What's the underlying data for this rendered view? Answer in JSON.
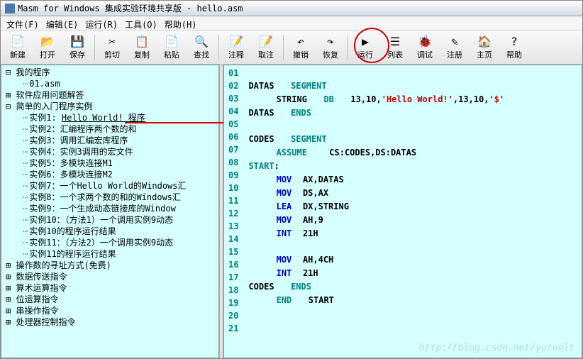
{
  "title": "Masm for Windows 集成实验环境共享版 - hello.asm",
  "menu": [
    "文件(F)",
    "编辑(E)",
    "运行(R)",
    "工具(O)",
    "帮助(H)"
  ],
  "toolbar": [
    {
      "name": "new",
      "icon": "📄",
      "label": "新建"
    },
    {
      "name": "open",
      "icon": "📂",
      "label": "打开"
    },
    {
      "name": "save",
      "icon": "💾",
      "label": "保存"
    },
    {
      "sep": true
    },
    {
      "name": "cut",
      "icon": "✂",
      "label": "剪切"
    },
    {
      "name": "copy",
      "icon": "📋",
      "label": "复制"
    },
    {
      "name": "paste",
      "icon": "📄",
      "label": "粘贴"
    },
    {
      "name": "find",
      "icon": "🔍",
      "label": "查找"
    },
    {
      "sep": true
    },
    {
      "name": "comment",
      "icon": "📝",
      "label": "注释"
    },
    {
      "name": "uncomment",
      "icon": "📝",
      "label": "取注"
    },
    {
      "sep": true
    },
    {
      "name": "undo",
      "icon": "↶",
      "label": "撤销"
    },
    {
      "name": "redo",
      "icon": "↷",
      "label": "恢复"
    },
    {
      "sep": true
    },
    {
      "name": "run",
      "icon": "▶",
      "label": "运行"
    },
    {
      "name": "list",
      "icon": "☰",
      "label": "列表"
    },
    {
      "name": "debug",
      "icon": "🐞",
      "label": "调试"
    },
    {
      "name": "register",
      "icon": "✎",
      "label": "注册"
    },
    {
      "name": "home",
      "icon": "🏠",
      "label": "主页"
    },
    {
      "name": "help",
      "icon": "?",
      "label": "帮助"
    }
  ],
  "tree": {
    "root1": "我的程序",
    "leaf1": "01.asm",
    "n2": "软件应用问题解答",
    "n3": "简单的入门程序实例",
    "ex": [
      "实例1:  Hello World! 程序",
      "实例2：汇编程序两个数的和",
      "实例3：调用汇编宏库程序",
      "实例4：实例3调用的宏文件",
      "实例5：多模块连接M1",
      "实例6：多模块连接M2",
      "实例7：一个Hello World的Windows汇",
      "实例8：一个求两个数的和的Windows汇",
      "实例9：一个生成动态链接库的Window",
      "实例10：（方法1）一个调用实例9动态",
      "实例10的程序运行结果",
      "实例11：（方法2）一个调用实例9动态",
      "实例11的程序运行结果"
    ],
    "rest": [
      "操作数的寻址方式(免费)",
      "数据传送指令",
      "算术运算指令",
      "位运算指令",
      "串操作指令",
      "处理器控制指令"
    ]
  },
  "code": {
    "lines": 21,
    "l01a": "DATAS",
    "l01b": "SEGMENT",
    "l02a": "STRING",
    "l02b": "DB",
    "l02c": "13,10,",
    "l02d": "'Hello World!'",
    "l02e": ",13,10,",
    "l02f": "'$'",
    "l03a": "DATAS",
    "l03b": "ENDS",
    "l05a": "CODES",
    "l05b": "SEGMENT",
    "l06a": "ASSUME",
    "l06b": "CS:CODES,DS:DATAS",
    "l07a": "START",
    "l07b": ":",
    "l08a": "MOV",
    "l08b": "AX,DATAS",
    "l09a": "MOV",
    "l09b": "DS,AX",
    "l10a": "LEA",
    "l10b": "DX,STRING",
    "l11a": "MOV",
    "l11b": "AH,9",
    "l12a": "INT",
    "l12b": "21H",
    "l14a": "MOV",
    "l14b": "AH,4CH",
    "l15a": "INT",
    "l15b": "21H",
    "l16a": "CODES",
    "l16b": "ENDS",
    "l17a": "END",
    "l17b": "START"
  },
  "watermark": "http://blog.csdn.net/yuruolt"
}
